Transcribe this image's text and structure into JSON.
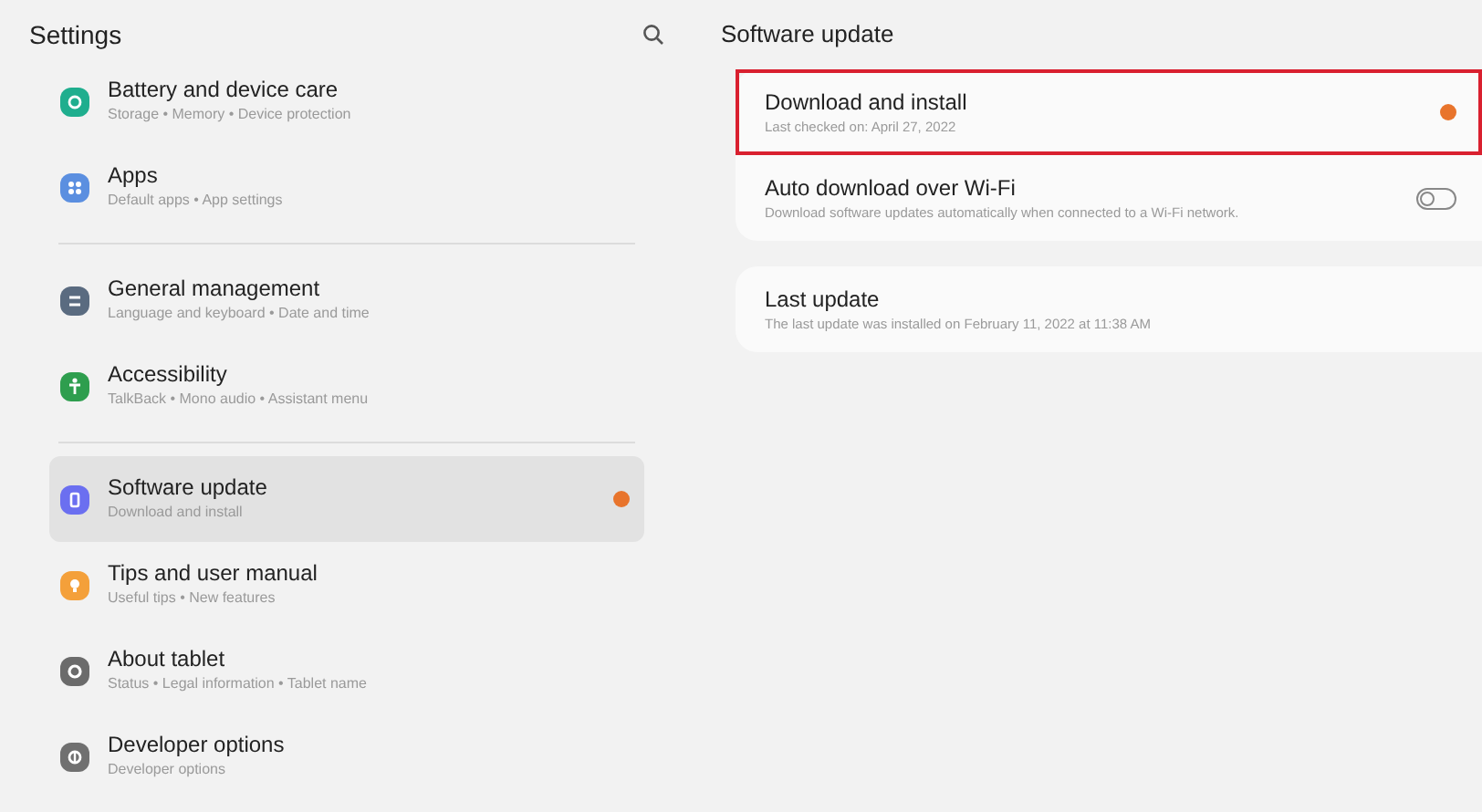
{
  "sidebar": {
    "title": "Settings",
    "groups": [
      [
        {
          "title": "Battery and device care",
          "subtitle": "Storage • Memory • Device protection",
          "color": "#1fae8e",
          "selected": false,
          "badge": false
        },
        {
          "title": "Apps",
          "subtitle": "Default apps • App settings",
          "color": "#5b8fe0",
          "selected": false,
          "badge": false
        }
      ],
      [
        {
          "title": "General management",
          "subtitle": "Language and keyboard • Date and time",
          "color": "#5a6b80",
          "selected": false,
          "badge": false
        },
        {
          "title": "Accessibility",
          "subtitle": "TalkBack • Mono audio • Assistant menu",
          "color": "#2e9e4e",
          "selected": false,
          "badge": false
        }
      ],
      [
        {
          "title": "Software update",
          "subtitle": "Download and install",
          "color": "#6b6ff0",
          "selected": true,
          "badge": true
        },
        {
          "title": "Tips and user manual",
          "subtitle": "Useful tips • New features",
          "color": "#f4a03a",
          "selected": false,
          "badge": false
        },
        {
          "title": "About tablet",
          "subtitle": "Status • Legal information • Tablet name",
          "color": "#6b6b6b",
          "selected": false,
          "badge": false
        },
        {
          "title": "Developer options",
          "subtitle": "Developer options",
          "color": "#707070",
          "selected": false,
          "badge": false
        }
      ]
    ]
  },
  "detail": {
    "title": "Software update",
    "cards": [
      [
        {
          "kind": "action",
          "title": "Download and install",
          "subtitle": "Last checked on: April 27, 2022",
          "badge": true,
          "highlighted": true
        },
        {
          "kind": "toggle",
          "title": "Auto download over Wi-Fi",
          "subtitle": "Download software updates automatically when connected to a Wi-Fi network.",
          "on": false,
          "highlighted": false
        }
      ],
      [
        {
          "kind": "info",
          "title": "Last update",
          "subtitle": "The last update was installed on February 11, 2022 at 11:38 AM",
          "highlighted": false
        }
      ]
    ]
  }
}
